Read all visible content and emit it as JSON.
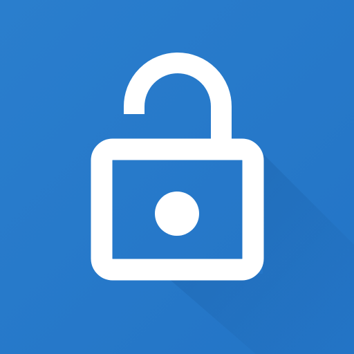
{
  "icon": {
    "name": "unlocked-padlock-icon",
    "colors": {
      "background": "#2374C6",
      "background_light": "#2A7ECD",
      "foreground": "#FFFFFF",
      "shadow": "#1B5FA6"
    }
  }
}
